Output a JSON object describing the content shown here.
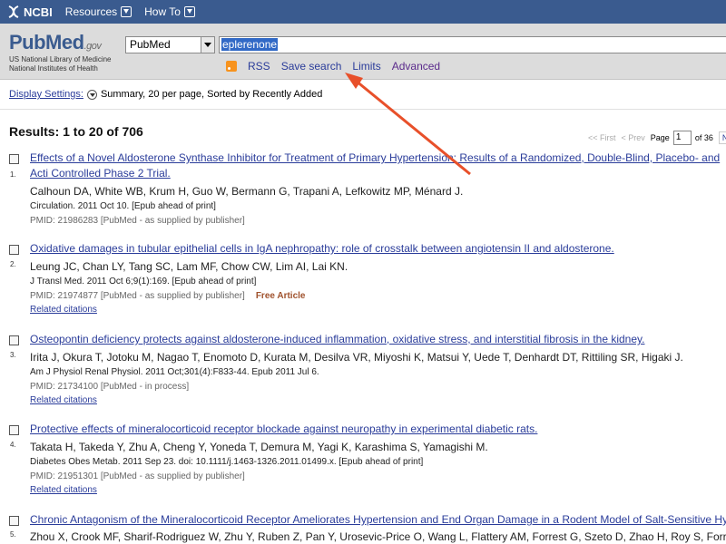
{
  "topbar": {
    "logo": "NCBI",
    "menu": [
      "Resources",
      "How To"
    ]
  },
  "header": {
    "logo_main": "PubMed",
    "logo_gov": ".gov",
    "logo_sub1": "US National Library of Medicine",
    "logo_sub2": "National Institutes of Health",
    "db_selected": "PubMed",
    "search_value": "eplerenone",
    "links": {
      "rss": "RSS",
      "save_search": "Save search",
      "limits": "Limits",
      "advanced": "Advanced"
    }
  },
  "display": {
    "link": "Display Settings:",
    "summary": "Summary, 20 per page, Sorted by Recently Added"
  },
  "results_title": "Results: 1 to 20 of 706",
  "pager": {
    "first": "<< First",
    "prev": "< Prev",
    "page_label": "Page",
    "page_value": "1",
    "of": "of 36",
    "next": "Ne"
  },
  "results": [
    {
      "num": "1.",
      "title": "Effects of a Novel Aldosterone Synthase Inhibitor for Treatment of Primary Hypertension: Results of a Randomized, Double-Blind, Placebo- and Acti Controlled Phase 2 Trial.",
      "authors": "Calhoun DA, White WB, Krum H, Guo W, Bermann G, Trapani A, Lefkowitz MP, Ménard J.",
      "journal": "Circulation. 2011 Oct 10. [Epub ahead of print]",
      "pmid": "PMID: 21986283 [PubMed - as supplied by publisher]",
      "free": "",
      "related": ""
    },
    {
      "num": "2.",
      "title": "Oxidative damages in tubular epithelial cells in IgA nephropathy: role of crosstalk between angiotensin II and aldosterone.",
      "authors": "Leung JC, Chan LY, Tang SC, Lam MF, Chow CW, Lim AI, Lai KN.",
      "journal": "J Transl Med. 2011 Oct 6;9(1):169. [Epub ahead of print]",
      "pmid": "PMID: 21974877 [PubMed - as supplied by publisher]",
      "free": "Free Article",
      "related": "Related citations"
    },
    {
      "num": "3.",
      "title": "Osteopontin deficiency protects against aldosterone-induced inflammation, oxidative stress, and interstitial fibrosis in the kidney.",
      "authors": "Irita J, Okura T, Jotoku M, Nagao T, Enomoto D, Kurata M, Desilva VR, Miyoshi K, Matsui Y, Uede T, Denhardt DT, Rittiling SR, Higaki J.",
      "journal": "Am J Physiol Renal Physiol. 2011 Oct;301(4):F833-44. Epub 2011 Jul 6.",
      "pmid": "PMID: 21734100 [PubMed - in process]",
      "free": "",
      "related": "Related citations"
    },
    {
      "num": "4.",
      "title": "Protective effects of mineralocorticoid receptor blockade against neuropathy in experimental diabetic rats.",
      "authors": "Takata H, Takeda Y, Zhu A, Cheng Y, Yoneda T, Demura M, Yagi K, Karashima S, Yamagishi M.",
      "journal": "Diabetes Obes Metab. 2011 Sep 23. doi: 10.1111/j.1463-1326.2011.01499.x. [Epub ahead of print]",
      "pmid": "PMID: 21951301 [PubMed - as supplied by publisher]",
      "free": "",
      "related": "Related citations"
    },
    {
      "num": "5.",
      "title": "Chronic Antagonism of the Mineralocorticoid Receptor Ameliorates Hypertension and End Organ Damage in a Rodent Model of Salt-Sensitive Hype",
      "authors": "Zhou X, Crook MF, Sharif-Rodriguez W, Zhu Y, Ruben Z, Pan Y, Urosevic-Price O, Wang L, Flattery AM, Forrest G, Szeto D, Zhao H, Roy S, Forres",
      "journal": "",
      "pmid": "",
      "free": "",
      "related": ""
    }
  ],
  "colors": {
    "topbar": "#3a5b8f",
    "link": "#2a3c9a",
    "annotation_arrow": "#e8502a"
  }
}
